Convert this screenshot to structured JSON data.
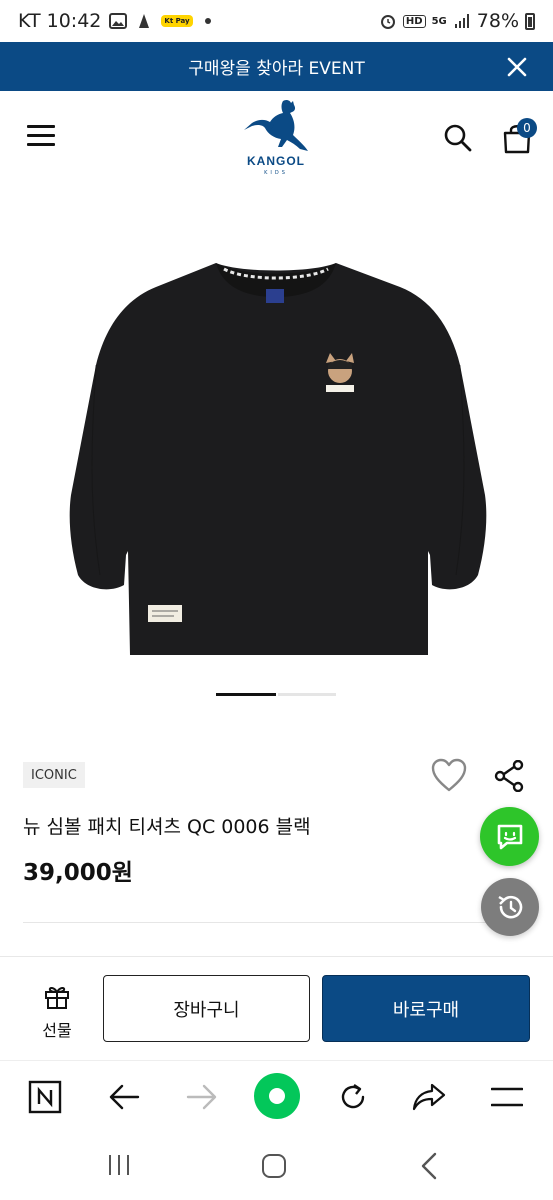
{
  "status_bar": {
    "carrier_time": "KT 10:42",
    "kpay_label": "Kt Pay",
    "network_hd": "HD",
    "network_5g": "5G",
    "battery": "78%"
  },
  "banner": {
    "text": "구매왕을 찾아라 EVENT",
    "close_icon": "close-icon"
  },
  "header": {
    "brand": "KANGOL",
    "sub_brand": "KIDS",
    "cart_count": "0"
  },
  "gallery": {
    "current_slide": 1,
    "total_slides": 2
  },
  "product": {
    "tag": "ICONIC",
    "title": "뉴 심볼 패치 티셔츠 QC 0006 블랙",
    "price": "39,000원"
  },
  "buy_bar": {
    "gift_label": "선물",
    "cart_label": "장바구니",
    "buy_label": "바로구매"
  },
  "colors": {
    "brand_navy": "#0b4a85",
    "chat_green": "#2ec52a",
    "history_gray": "#7d7d7d",
    "browser_accent": "#03c75a"
  }
}
